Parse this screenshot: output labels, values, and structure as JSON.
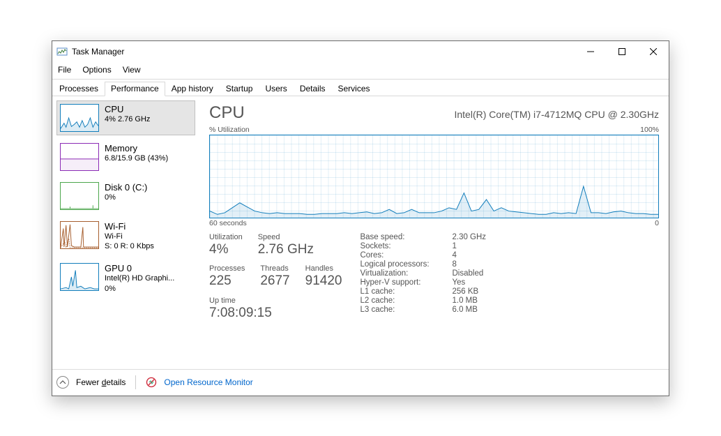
{
  "window": {
    "title": "Task Manager"
  },
  "menu": {
    "file": "File",
    "options": "Options",
    "view": "View"
  },
  "tabs": [
    "Processes",
    "Performance",
    "App history",
    "Startup",
    "Users",
    "Details",
    "Services"
  ],
  "sidebar": {
    "cpu": {
      "name": "CPU",
      "sub": "4%  2.76 GHz"
    },
    "memory": {
      "name": "Memory",
      "sub": "6.8/15.9 GB (43%)"
    },
    "disk": {
      "name": "Disk 0 (C:)",
      "sub": "0%"
    },
    "wifi": {
      "name": "Wi-Fi",
      "sub1": "Wi-Fi",
      "sub2": "S: 0 R: 0 Kbps"
    },
    "gpu": {
      "name": "GPU 0",
      "sub1": "Intel(R) HD Graphi...",
      "sub2": "0%"
    }
  },
  "main": {
    "title": "CPU",
    "device": "Intel(R) Core(TM) i7-4712MQ CPU @ 2.30GHz",
    "util_label": "% Utilization",
    "max_label": "100%",
    "x_start": "60 seconds",
    "x_end": "0",
    "stats": {
      "utilization": {
        "label": "Utilization",
        "value": "4%"
      },
      "speed": {
        "label": "Speed",
        "value": "2.76 GHz"
      },
      "processes": {
        "label": "Processes",
        "value": "225"
      },
      "threads": {
        "label": "Threads",
        "value": "2677"
      },
      "handles": {
        "label": "Handles",
        "value": "91420"
      },
      "uptime": {
        "label": "Up time",
        "value": "7:08:09:15"
      }
    },
    "info": {
      "base_speed": {
        "label": "Base speed:",
        "value": "2.30 GHz"
      },
      "sockets": {
        "label": "Sockets:",
        "value": "1"
      },
      "cores": {
        "label": "Cores:",
        "value": "4"
      },
      "logical": {
        "label": "Logical processors:",
        "value": "8"
      },
      "virtualization": {
        "label": "Virtualization:",
        "value": "Disabled"
      },
      "hyperv": {
        "label": "Hyper-V support:",
        "value": "Yes"
      },
      "l1": {
        "label": "L1 cache:",
        "value": "256 KB"
      },
      "l2": {
        "label": "L2 cache:",
        "value": "1.0 MB"
      },
      "l3": {
        "label": "L3 cache:",
        "value": "6.0 MB"
      }
    }
  },
  "footer": {
    "fewer_prefix": "Fewer ",
    "fewer_underlined": "d",
    "fewer_suffix": "etails",
    "resource_monitor": "Open Resource Monitor"
  },
  "colors": {
    "cpu": "#117dbb",
    "memory": "#8b2bb5",
    "disk": "#4ca64c",
    "wifi": "#a65e2e",
    "gpu": "#117dbb"
  },
  "chart_data": {
    "type": "area",
    "title": "CPU % Utilization",
    "xlabel": "seconds",
    "ylabel": "% Utilization",
    "xlim": [
      60,
      0
    ],
    "ylim": [
      0,
      100
    ],
    "x": [
      60,
      59,
      58,
      57,
      56,
      55,
      54,
      53,
      52,
      51,
      50,
      49,
      48,
      47,
      46,
      45,
      44,
      43,
      42,
      41,
      40,
      39,
      38,
      37,
      36,
      35,
      34,
      33,
      32,
      31,
      30,
      29,
      28,
      27,
      26,
      25,
      24,
      23,
      22,
      21,
      20,
      19,
      18,
      17,
      16,
      15,
      14,
      13,
      12,
      11,
      10,
      9,
      8,
      7,
      6,
      5,
      4,
      3,
      2,
      1,
      0
    ],
    "values": [
      8,
      4,
      6,
      12,
      18,
      13,
      8,
      6,
      5,
      6,
      5,
      5,
      5,
      4,
      4,
      5,
      5,
      5,
      6,
      5,
      6,
      7,
      5,
      6,
      10,
      5,
      6,
      10,
      6,
      6,
      6,
      8,
      12,
      10,
      30,
      8,
      10,
      22,
      8,
      12,
      8,
      7,
      6,
      5,
      4,
      4,
      6,
      5,
      6,
      5,
      38,
      6,
      6,
      5,
      7,
      8,
      6,
      5,
      5,
      4,
      4
    ]
  }
}
